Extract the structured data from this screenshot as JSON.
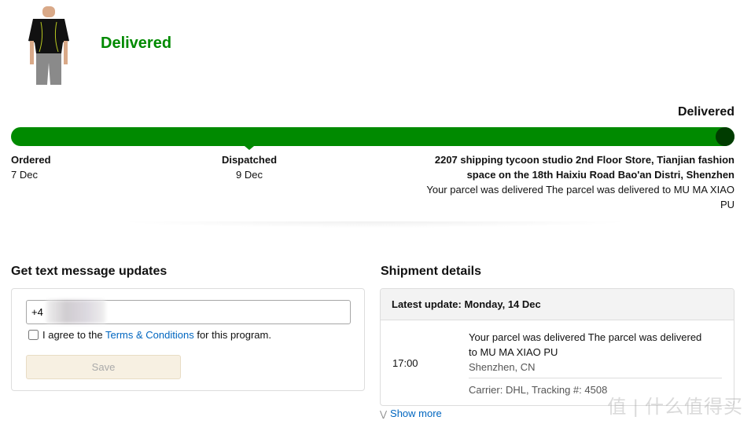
{
  "header": {
    "status_title": "Delivered",
    "product_image": "black compression t-shirt"
  },
  "progress": {
    "end_label": "Delivered",
    "percent": 100,
    "colors": {
      "fill": "#008a00",
      "end_dot": "#003c00"
    },
    "steps": [
      {
        "name": "Ordered",
        "date": "7 Dec"
      },
      {
        "name": "Dispatched",
        "date": "9 Dec"
      },
      {
        "address": "2207 shipping tycoon studio 2nd Floor Store, Tianjian fashion space on the 18th Haixiu Road Bao'an Distri, Shenzhen",
        "message": "Your parcel was delivered The parcel was delivered to MU MA XIAO PU"
      }
    ]
  },
  "sms": {
    "title": "Get text message updates",
    "phone_value": "+4",
    "agree_prefix": "I agree to the ",
    "terms_link": "Terms & Conditions",
    "agree_suffix": " for this program.",
    "save_label": "Save"
  },
  "shipment": {
    "title": "Shipment details",
    "latest_update": "Latest update: Monday, 14 Dec",
    "event": {
      "time": "17:00",
      "message": "Your parcel was delivered The parcel was delivered to MU MA XIAO PU",
      "location": "Shenzhen, CN",
      "carrier": "Carrier: DHL, Tracking #: 4508"
    },
    "show_more": "Show more"
  },
  "watermark": "值 | 什么值得买"
}
